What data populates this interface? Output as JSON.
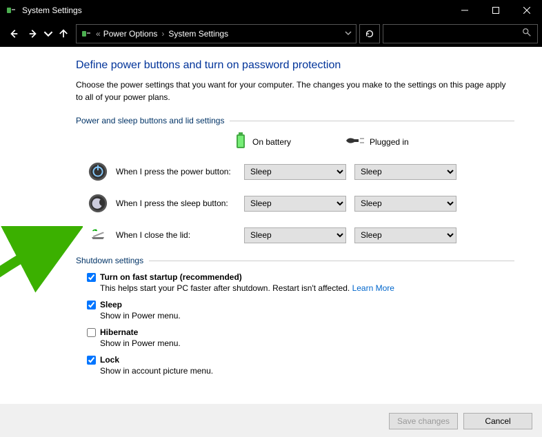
{
  "window_title": "System Settings",
  "breadcrumb": {
    "a": "Power Options",
    "b": "System Settings"
  },
  "heading": "Define power buttons and turn on password protection",
  "description": "Choose the power settings that you want for your computer. The changes you make to the settings on this page apply to all of your power plans.",
  "section1_title": "Power and sleep buttons and lid settings",
  "col_battery": "On battery",
  "col_plugged": "Plugged in",
  "rows": {
    "power": {
      "label": "When I press the power button:",
      "battery": "Sleep",
      "plugged": "Sleep"
    },
    "sleep": {
      "label": "When I press the sleep button:",
      "battery": "Sleep",
      "plugged": "Sleep"
    },
    "lid": {
      "label": "When I close the lid:",
      "battery": "Sleep",
      "plugged": "Sleep"
    }
  },
  "section2_title": "Shutdown settings",
  "shutdown": {
    "fast": {
      "checked": true,
      "label": "Turn on fast startup (recommended)",
      "sub": "This helps start your PC faster after shutdown. Restart isn't affected. ",
      "link": "Learn More"
    },
    "sleep": {
      "checked": true,
      "label": "Sleep",
      "sub": "Show in Power menu."
    },
    "hib": {
      "checked": false,
      "label": "Hibernate",
      "sub": "Show in Power menu."
    },
    "lock": {
      "checked": true,
      "label": "Lock",
      "sub": "Show in account picture menu."
    }
  },
  "buttons": {
    "save": "Save changes",
    "cancel": "Cancel"
  }
}
